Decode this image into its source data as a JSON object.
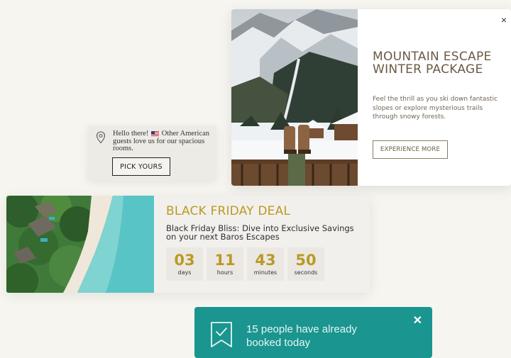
{
  "mountain": {
    "title_line1": "MOUNTAIN ESCAPE",
    "title_line2": "WINTER PACKAGE",
    "description": "Feel the thrill as you ski down fantastic slopes or explore mysterious trails through snowy forests.",
    "button_label": "EXPERIENCE MORE",
    "close_label": "×"
  },
  "hello": {
    "text_before_flag": "Hello there! ",
    "text_after_flag": " Other American guests love us for our spacious rooms.",
    "button_label": "PICK YOURS"
  },
  "black_friday": {
    "title": "BLACK FRIDAY DEAL",
    "description": "Black Friday Bliss: Dive into Exclusive Savings on your next Baros Escapes",
    "countdown": [
      {
        "value": "03",
        "label": "days"
      },
      {
        "value": "11",
        "label": "hours"
      },
      {
        "value": "43",
        "label": "minutes"
      },
      {
        "value": "50",
        "label": "seconds"
      }
    ]
  },
  "booking": {
    "message": "15 people have already booked today",
    "close_label": "✕"
  },
  "colors": {
    "gold": "#b99a24",
    "teal": "#1a9590",
    "brown": "#6b5a44"
  }
}
